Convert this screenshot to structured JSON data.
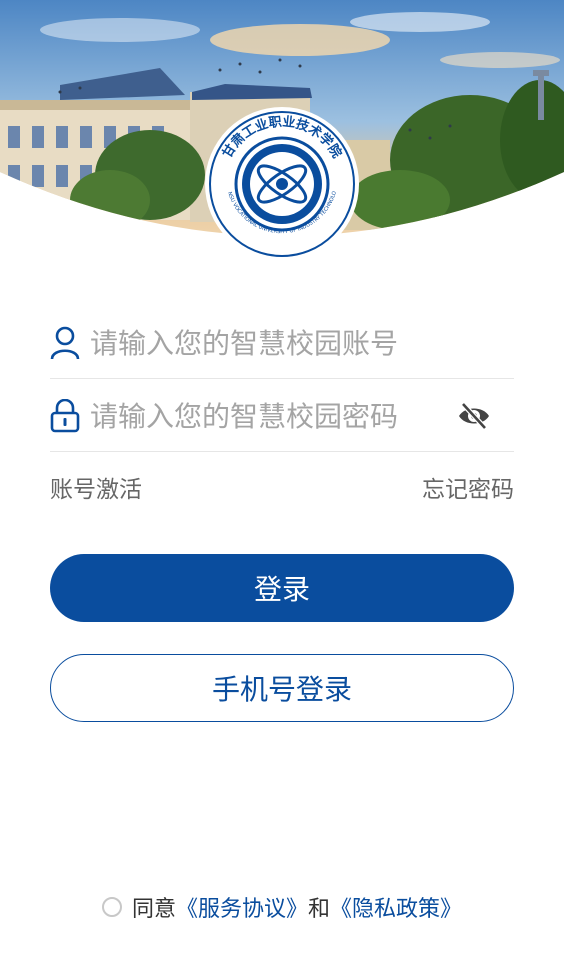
{
  "header": {
    "logo_text": "甘肃工业职业技术学院",
    "logo_text_en": "GANSU VOCATIONAL UNIVERSITY OF INDUSTRY TECHNOLOGY"
  },
  "login": {
    "username_placeholder": "请输入您的智慧校园账号",
    "password_placeholder": "请输入您的智慧校园密码",
    "activate_label": "账号激活",
    "forgot_label": "忘记密码",
    "login_button": "登录",
    "phone_login_button": "手机号登录"
  },
  "agreement": {
    "prefix": "同意",
    "service_link": "《服务协议》",
    "conjunction": "和",
    "privacy_link": "《隐私政策》"
  },
  "icons": {
    "user": "user-icon",
    "lock": "lock-icon",
    "eye": "eye-off-icon"
  },
  "colors": {
    "primary": "#0a4d9e",
    "placeholder": "#a4a4a4",
    "link_text": "#666666"
  }
}
